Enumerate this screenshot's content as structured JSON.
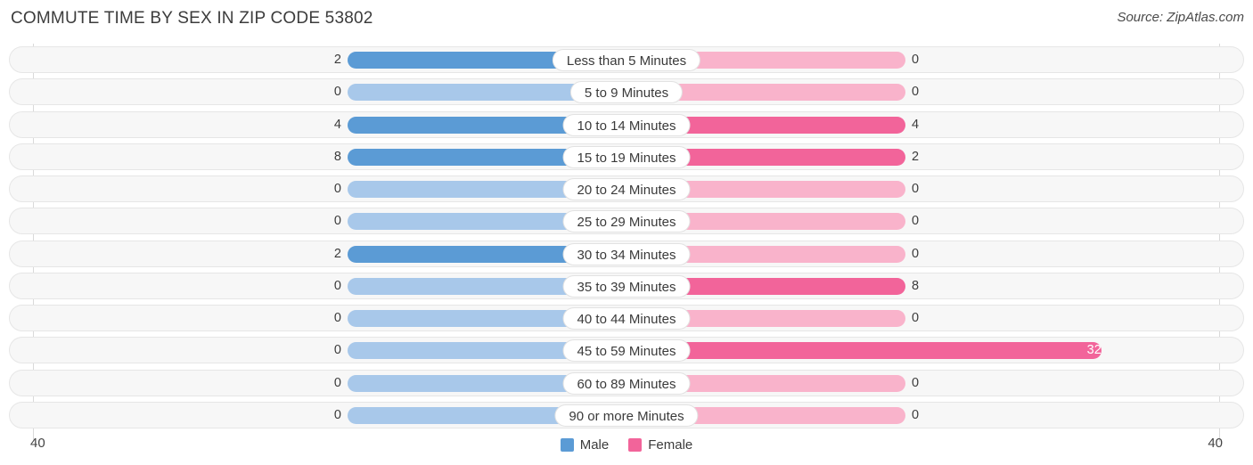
{
  "header": {
    "title": "COMMUTE TIME BY SEX IN ZIP CODE 53802",
    "source": "Source: ZipAtlas.com"
  },
  "axis": {
    "left_max": "40",
    "right_max": "40"
  },
  "legend": {
    "items": [
      {
        "label": "Male",
        "color": "#5b9bd5"
      },
      {
        "label": "Female",
        "color": "#f2649a"
      }
    ]
  },
  "colors": {
    "male_strong": "#5b9bd5",
    "male_light": "#a8c8ea",
    "female_strong": "#f2649a",
    "female_light": "#f9b3cb",
    "track_bg": "#f7f7f7",
    "track_border": "#e6e6e6",
    "gridline": "#d9d9d9"
  },
  "chart_data": {
    "type": "bar",
    "title": "Commute Time by Sex in Zip Code 53802",
    "subtitle": "Source: ZipAtlas.com",
    "orientation": "horizontal-diverging",
    "xlabel": "",
    "ylabel": "",
    "xlim": [
      40,
      40
    ],
    "axis_max_left": 40,
    "axis_max_right": 40,
    "grid": false,
    "legend_position": "bottom-center",
    "categories": [
      "Less than 5 Minutes",
      "5 to 9 Minutes",
      "10 to 14 Minutes",
      "15 to 19 Minutes",
      "20 to 24 Minutes",
      "25 to 29 Minutes",
      "30 to 34 Minutes",
      "35 to 39 Minutes",
      "40 to 44 Minutes",
      "45 to 59 Minutes",
      "60 to 89 Minutes",
      "90 or more Minutes"
    ],
    "series": [
      {
        "name": "Male",
        "values": [
          2,
          0,
          4,
          8,
          0,
          0,
          2,
          0,
          0,
          0,
          0,
          0
        ]
      },
      {
        "name": "Female",
        "values": [
          0,
          0,
          4,
          2,
          0,
          0,
          0,
          8,
          0,
          32,
          0,
          0
        ]
      }
    ]
  },
  "rows": [
    {
      "label": "Less than 5 Minutes",
      "male": "2",
      "female": "0",
      "male_value": 2,
      "female_value": 0
    },
    {
      "label": "5 to 9 Minutes",
      "male": "0",
      "female": "0",
      "male_value": 0,
      "female_value": 0
    },
    {
      "label": "10 to 14 Minutes",
      "male": "4",
      "female": "4",
      "male_value": 4,
      "female_value": 4
    },
    {
      "label": "15 to 19 Minutes",
      "male": "8",
      "female": "2",
      "male_value": 8,
      "female_value": 2
    },
    {
      "label": "20 to 24 Minutes",
      "male": "0",
      "female": "0",
      "male_value": 0,
      "female_value": 0
    },
    {
      "label": "25 to 29 Minutes",
      "male": "0",
      "female": "0",
      "male_value": 0,
      "female_value": 0
    },
    {
      "label": "30 to 34 Minutes",
      "male": "2",
      "female": "0",
      "male_value": 2,
      "female_value": 0
    },
    {
      "label": "35 to 39 Minutes",
      "male": "0",
      "female": "8",
      "male_value": 0,
      "female_value": 8
    },
    {
      "label": "40 to 44 Minutes",
      "male": "0",
      "female": "0",
      "male_value": 0,
      "female_value": 0
    },
    {
      "label": "45 to 59 Minutes",
      "male": "0",
      "female": "32",
      "male_value": 0,
      "female_value": 32
    },
    {
      "label": "60 to 89 Minutes",
      "male": "0",
      "female": "0",
      "male_value": 0,
      "female_value": 0
    },
    {
      "label": "90 or more Minutes",
      "male": "0",
      "female": "0",
      "male_value": 0,
      "female_value": 0
    }
  ]
}
